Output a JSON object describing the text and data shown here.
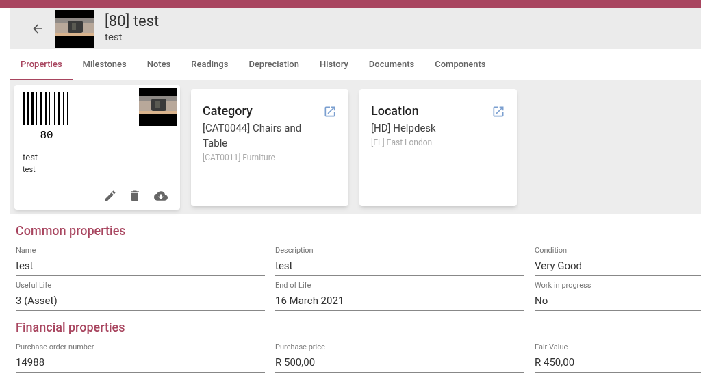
{
  "header": {
    "title": "[80] test",
    "subtitle": "test"
  },
  "tabs": [
    {
      "label": "Properties",
      "selected": true
    },
    {
      "label": "Milestones",
      "selected": false
    },
    {
      "label": "Notes",
      "selected": false
    },
    {
      "label": "Readings",
      "selected": false
    },
    {
      "label": "Depreciation",
      "selected": false
    },
    {
      "label": "History",
      "selected": false
    },
    {
      "label": "Documents",
      "selected": false
    },
    {
      "label": "Components",
      "selected": false
    }
  ],
  "asset_card": {
    "barcode_number": "80",
    "name": "test",
    "description": "test"
  },
  "info_cards": [
    {
      "title": "Category",
      "primary": "[CAT0044] Chairs and Table",
      "secondary": "[CAT0011] Furniture"
    },
    {
      "title": "Location",
      "primary": "[HD] Helpdesk",
      "secondary": "[EL] East London"
    }
  ],
  "sections": [
    {
      "title": "Common properties",
      "fields": [
        {
          "label": "Name",
          "value": "test"
        },
        {
          "label": "Description",
          "value": "test"
        },
        {
          "label": "Condition",
          "value": "Very Good"
        },
        {
          "label": "Useful Life",
          "value": "3 (Asset)"
        },
        {
          "label": "End of Life",
          "value": "16 March 2021"
        },
        {
          "label": "Work in progress",
          "value": "No"
        }
      ]
    },
    {
      "title": "Financial properties",
      "fields": [
        {
          "label": "Purchase order number",
          "value": "14988"
        },
        {
          "label": "Purchase price",
          "value": "R 500,00"
        },
        {
          "label": "Fair Value",
          "value": "R 450,00"
        }
      ]
    }
  ]
}
